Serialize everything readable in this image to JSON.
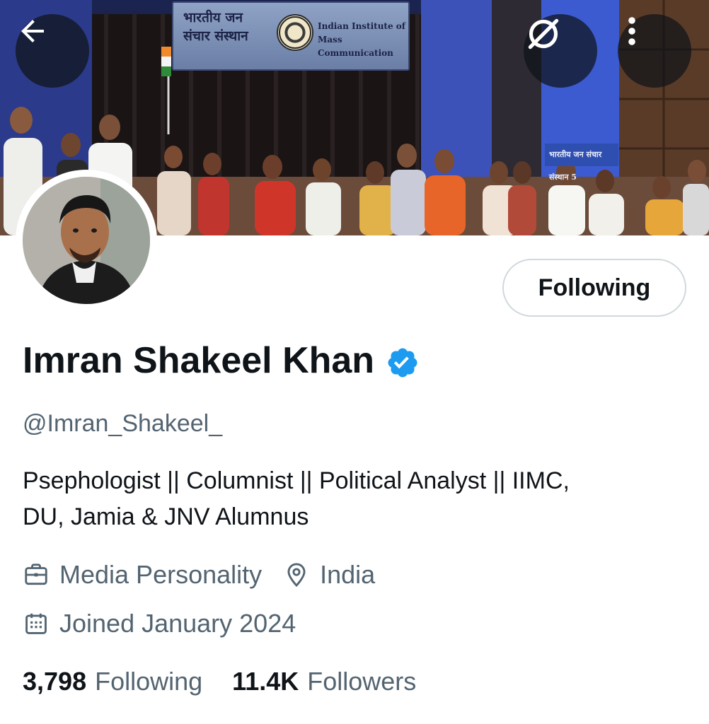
{
  "banner": {
    "sign_hindi_line1": "भारतीय जन",
    "sign_hindi_line2": "संचार संस्थान",
    "sign_english_line1": "Indian Institute of",
    "sign_english_line2": "Mass Communication",
    "side_sign": "भारतीय जन संचार संस्थान 5"
  },
  "nav": {
    "back_icon": "arrow-left-icon",
    "search_icon": "search-off-icon",
    "more_icon": "more-vertical-icon"
  },
  "profile": {
    "name": "Imran Shakeel Khan",
    "verified_icon": "verified-badge-icon",
    "verified_color": "#1d9bf0",
    "handle": "@Imran_Shakeel_",
    "bio_line1": "Psephologist || Columnist || Political Analyst || IIMC,",
    "bio_line2": "DU, Jamia & JNV Alumnus",
    "category": "Media Personality",
    "location": "India",
    "joined": "Joined January 2024"
  },
  "follow_button": {
    "label": "Following"
  },
  "stats": {
    "following_count": "3,798",
    "following_label": "Following",
    "followers_count": "11.4K",
    "followers_label": "Followers"
  },
  "colors": {
    "text_primary": "#0f1419",
    "text_secondary": "#536471",
    "border": "#cfd9de"
  }
}
